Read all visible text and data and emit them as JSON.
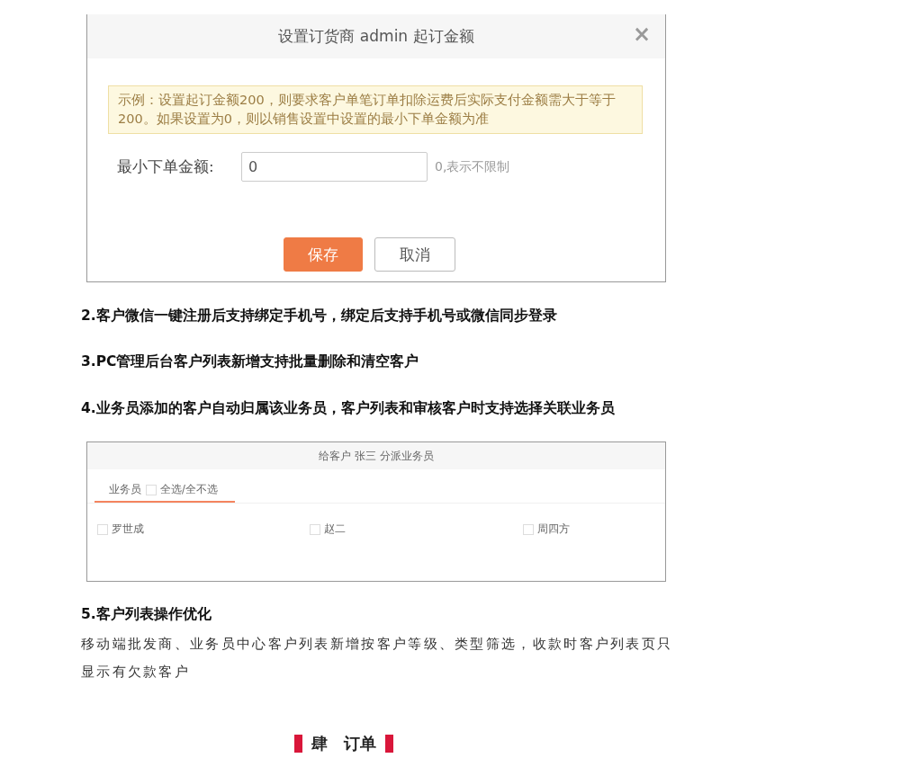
{
  "dialog_screenshot": {
    "title": "设置订货商 admin 起订金额",
    "close": "×",
    "notice": "示例：设置起订金额200，则要求客户单笔订单扣除运费后实际支付金额需大于等于200。如果设置为0，则以销售设置中设置的最小下单金额为准",
    "field_label": "最小下单金额:",
    "field_value": "0",
    "field_hint": "0,表示不限制",
    "buttons": [
      {
        "label": "保存",
        "kind": "primary"
      },
      {
        "label": "取消",
        "kind": "secondary"
      }
    ]
  },
  "headings": [
    "2.客户微信一键注册后支持绑定手机号，绑定后支持手机号或微信同步登录",
    "3.PC管理后台客户列表新增支持批量删除和清空客户",
    "4.业务员添加的客户自动归属该业务员，客户列表和审核客户时支持选择关联业务员"
  ],
  "assign_screenshot": {
    "title": "给客户 张三 分派业务员",
    "tab": "业务员",
    "select_all": {
      "label": "全选/全不选",
      "checked": false
    },
    "salespeople": [
      {
        "name": "罗世成",
        "checked": false
      },
      {
        "name": "赵二",
        "checked": false
      },
      {
        "name": "周四方",
        "checked": false
      }
    ]
  },
  "heading_5": "5.客户列表操作优化",
  "paragraph": "移动端批发商、业务员中心客户列表新增按客户等级、类型筛选，收款时客户列表页只显示有欠款客户",
  "section_title": {
    "number": "肆",
    "title": "订单"
  }
}
